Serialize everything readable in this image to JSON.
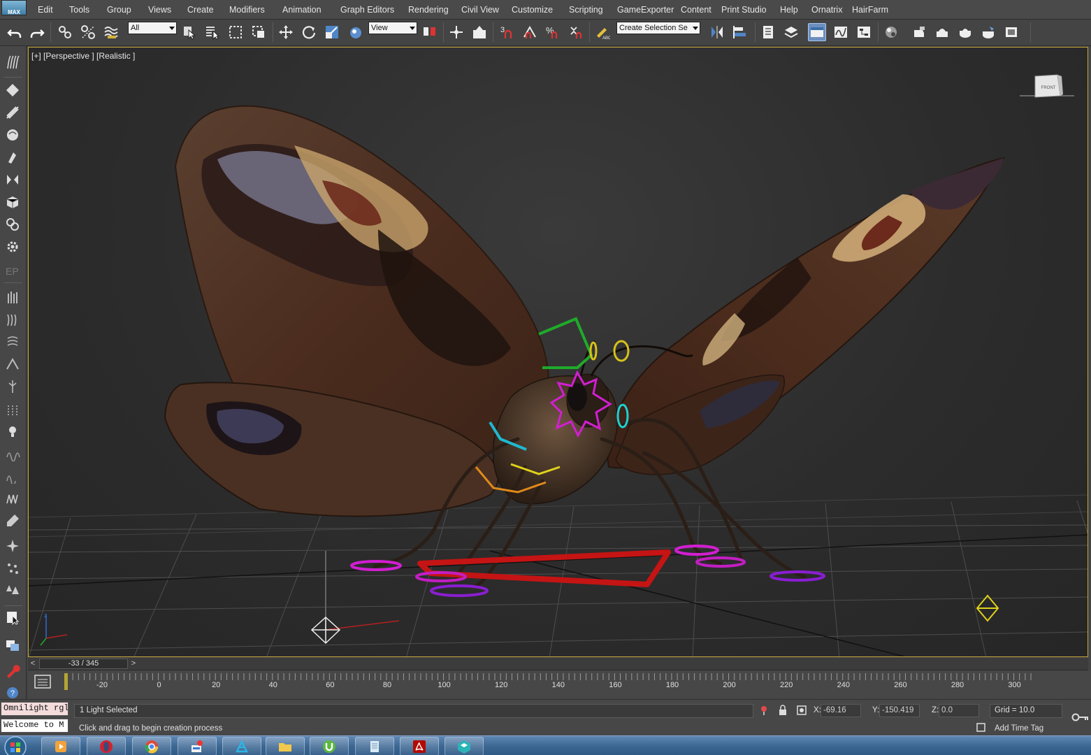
{
  "app": {
    "logo_text": "MAX"
  },
  "menu": [
    {
      "label": "Edit"
    },
    {
      "label": "Tools"
    },
    {
      "label": "Group"
    },
    {
      "label": "Views"
    },
    {
      "label": "Create"
    },
    {
      "label": "Modifiers"
    },
    {
      "label": "Animation"
    },
    {
      "label": "Graph Editors"
    },
    {
      "label": "Rendering"
    },
    {
      "label": "Civil View"
    },
    {
      "label": "Customize"
    },
    {
      "label": "Scripting"
    },
    {
      "label": "GameExporter"
    },
    {
      "label": "Content"
    },
    {
      "label": "Print Studio"
    },
    {
      "label": "Help"
    },
    {
      "label": "Ornatrix"
    },
    {
      "label": "HairFarm"
    }
  ],
  "toolbar": {
    "selection_filter": "All",
    "reference_coord": "View",
    "named_selection": "Create Selection Se",
    "snap_3_label": "3",
    "percent_snap_label": "%"
  },
  "viewport": {
    "label": "[+] [Perspective ] [Realistic ]",
    "viewcube_face": "FRONT",
    "accent_border": "#c4a73a"
  },
  "timeline": {
    "frame_display": "-33 / 345",
    "prev_label": "<",
    "next_label": ">",
    "ticks": [
      "-20",
      "0",
      "20",
      "40",
      "60",
      "80",
      "100",
      "120",
      "140",
      "160",
      "180",
      "200",
      "220",
      "240",
      "260",
      "280",
      "300"
    ]
  },
  "status": {
    "script_listener_line1": "Omnilight rgl",
    "script_listener_line2": "Welcome to M",
    "selection_text": "1 Light Selected",
    "prompt_text": "Click and drag to begin creation process",
    "x_label": "X:",
    "x_value": "-69.16",
    "y_label": "Y:",
    "y_value": "-150.419",
    "z_label": "Z:",
    "z_value": "0.0",
    "grid_label": "Grid = 10.0",
    "add_time_tag": "Add Time Tag"
  },
  "taskbar": {
    "apps": [
      "windows-start",
      "media-player",
      "opera",
      "chrome",
      "paint",
      "3d-app",
      "file-explorer",
      "utorrent",
      "notepad",
      "acrobat",
      "3ds-max"
    ]
  }
}
